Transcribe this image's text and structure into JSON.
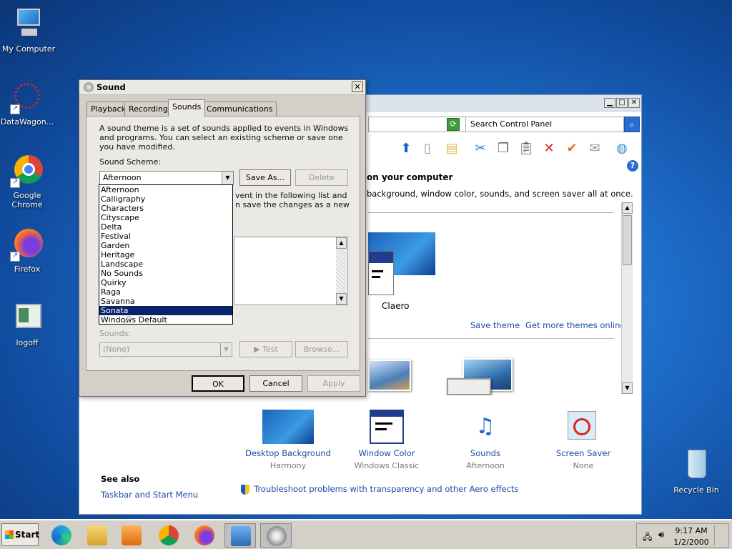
{
  "desktop": {
    "icons": [
      {
        "label": "My Computer"
      },
      {
        "label": "DataWagon..."
      },
      {
        "label": "Google Chrome"
      },
      {
        "label": "Firefox"
      },
      {
        "label": "logoff"
      },
      {
        "label": "Recycle Bin"
      }
    ]
  },
  "control_panel": {
    "search_placeholder": "Search Control Panel",
    "heading": "on your computer",
    "subheading": "background, window color, sounds, and screen saver all at once.",
    "theme_name": "Claero",
    "save_theme": "Save theme",
    "more_themes": "Get more themes online",
    "bottom_items": [
      {
        "title": "Desktop Background",
        "sub": "Harmony"
      },
      {
        "title": "Window Color",
        "sub": "Windows Classic"
      },
      {
        "title": "Sounds",
        "sub": "Afternoon"
      },
      {
        "title": "Screen Saver",
        "sub": "None"
      }
    ],
    "see_also": "See also",
    "taskbar_link": "Taskbar and Start Menu",
    "troubleshoot": "Troubleshoot problems with transparency and other Aero effects"
  },
  "sound_dialog": {
    "title": "Sound",
    "tabs": [
      "Playback",
      "Recording",
      "Sounds",
      "Communications"
    ],
    "active_tab": "Sounds",
    "description": "A sound theme is a set of sounds applied to events in Windows and programs.  You can select an existing scheme or save one you have modified.",
    "scheme_label": "Sound Scheme:",
    "scheme_value": "Afternoon",
    "save_as": "Save As...",
    "delete": "Delete",
    "hidden_text_1": "vent in the following list and",
    "hidden_text_2": "n save the changes as a new",
    "scheme_options": [
      "Afternoon",
      "Calligraphy",
      "Characters",
      "Cityscape",
      "Delta",
      "Festival",
      "Garden",
      "Heritage",
      "Landscape",
      "No Sounds",
      "Quirky",
      "Raga",
      "Savanna",
      "Sonata",
      "Windows Default"
    ],
    "highlighted_option": "Sonata",
    "sounds_label": "Sounds:",
    "sounds_value": "(None)",
    "test": "Test",
    "browse": "Browse...",
    "ok": "OK",
    "cancel": "Cancel",
    "apply": "Apply"
  },
  "taskbar": {
    "start": "Start",
    "time": "9:17 AM",
    "date": "1/2/2000"
  },
  "colors": {
    "selection": "#0a246a",
    "link": "#1a4aa6",
    "dialog_bg": "#d4d0c8"
  }
}
